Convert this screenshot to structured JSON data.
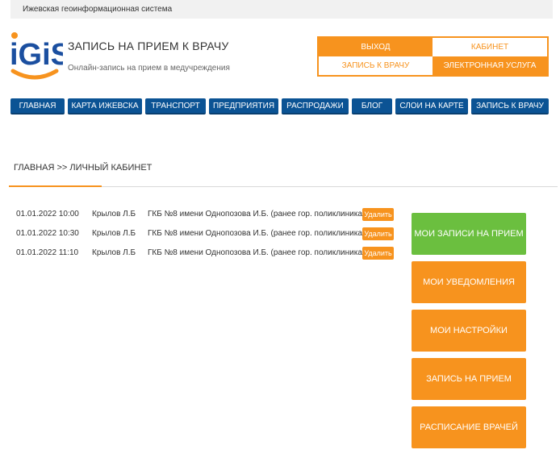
{
  "topbar": {
    "text": "Ижевская геоинформационная система"
  },
  "brand": {
    "logo_text": "iGiS",
    "title": "ЗАПИСЬ НА ПРИЕМ К ВРАЧУ",
    "subtitle": "Онлайн-запись на прием в медучреждения",
    "colors": {
      "blue": "#1b4fa0",
      "orange": "#f7931e"
    }
  },
  "auth": {
    "logout": "ВЫХОД",
    "cabinet": "КАБИНЕТ",
    "doctor_appointment": "ЗАПИСЬ К ВРАЧУ",
    "e_service": "ЭЛЕКТРОННАЯ УСЛУГА"
  },
  "nav": [
    "ГЛАВНАЯ",
    "КАРТА ИЖЕВСКА",
    "ТРАНСПОРТ",
    "ПРЕДПРИЯТИЯ",
    "РАСПРОДАЖИ",
    "БЛОГ",
    "СЛОИ НА КАРТЕ",
    "ЗАПИСЬ К ВРАЧУ"
  ],
  "breadcrumb": "ГЛАВНАЯ >> ЛИЧНЫЙ КАБИНЕТ",
  "appointments": [
    {
      "datetime": "01.01.2022 10:00",
      "doctor": "Крылов Л.Б",
      "clinic": "ГКБ №8 имени Однопозова И.Б. (ранее гор. поликлиника №3)",
      "delete": "Удалить"
    },
    {
      "datetime": "01.01.2022 10:30",
      "doctor": "Крылов Л.Б",
      "clinic": "ГКБ №8 имени Однопозова И.Б. (ранее гор. поликлиника №3)",
      "delete": "Удалить"
    },
    {
      "datetime": "01.01.2022 11:10",
      "doctor": "Крылов Л.Б",
      "clinic": "ГКБ №8 имени Однопозова И.Б. (ранее гор. поликлиника №3)",
      "delete": "Удалить"
    }
  ],
  "side_menu": [
    "МОИ ЗАПИСИ НА ПРИЕМ",
    "МОИ УВЕДОМЛЕНИЯ",
    "МОИ НАСТРОЙКИ",
    "ЗАПИСЬ НА ПРИЕМ",
    "РАСПИСАНИЕ ВРАЧЕЙ"
  ],
  "theme": {
    "nav_bg": "#0b5394",
    "accent": "#f7931e",
    "active": "#6bbf3f"
  }
}
